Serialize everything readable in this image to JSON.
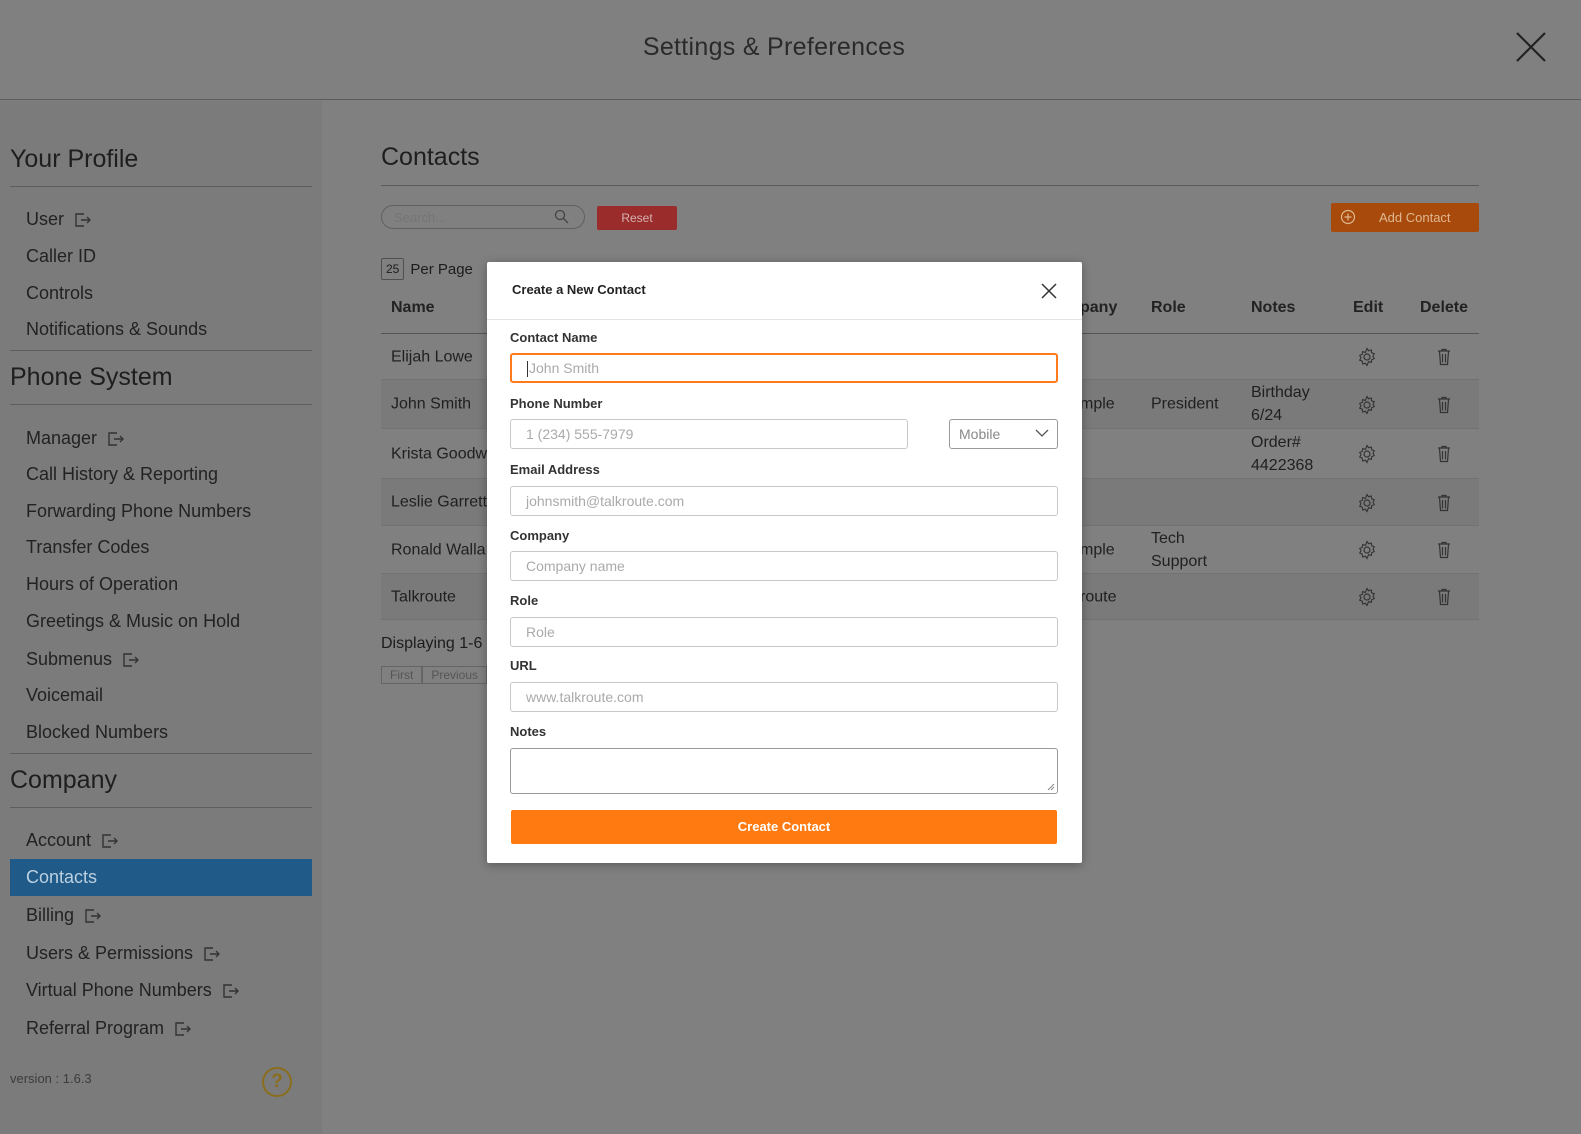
{
  "header": {
    "title": "Settings & Preferences",
    "close_icon": "close-icon"
  },
  "sidebar": {
    "sections": [
      {
        "title": "Your Profile",
        "items": [
          {
            "label": "User",
            "external": true
          },
          {
            "label": "Caller ID"
          },
          {
            "label": "Controls"
          },
          {
            "label": "Notifications & Sounds"
          }
        ]
      },
      {
        "title": "Phone System",
        "items": [
          {
            "label": "Manager",
            "external": true
          },
          {
            "label": "Call History & Reporting"
          },
          {
            "label": "Forwarding Phone Numbers"
          },
          {
            "label": "Transfer Codes"
          },
          {
            "label": "Hours of Operation"
          },
          {
            "label": "Greetings & Music on Hold"
          },
          {
            "label": "Submenus",
            "external": true
          },
          {
            "label": "Voicemail"
          },
          {
            "label": "Blocked Numbers"
          }
        ]
      },
      {
        "title": "Company",
        "items": [
          {
            "label": "Account",
            "external": true
          },
          {
            "label": "Contacts",
            "active": true
          },
          {
            "label": "Billing",
            "external": true
          },
          {
            "label": "Users & Permissions",
            "external": true
          },
          {
            "label": "Virtual Phone Numbers",
            "external": true
          },
          {
            "label": "Referral Program",
            "external": true
          }
        ]
      }
    ],
    "version": "version : 1.6.3",
    "help_icon": "question-circle-icon"
  },
  "main": {
    "title": "Contacts",
    "search_placeholder": "Search...",
    "reset_label": "Reset",
    "add_contact_label": "Add Contact",
    "per_page_value": "25",
    "per_page_label": "Per Page",
    "columns": [
      "Name",
      "pany",
      "Role",
      "Notes",
      "Edit",
      "Delete"
    ],
    "rows": [
      {
        "name": "Elijah Lowe",
        "company": "",
        "role": "",
        "notes": ""
      },
      {
        "name": "John Smith",
        "company": "mple",
        "role": "President",
        "notes": "Birthday 6/24"
      },
      {
        "name": "Krista Goodw",
        "company": "",
        "role": "",
        "notes": "Order# 4422368"
      },
      {
        "name": "Leslie Garrett",
        "company": "",
        "role": "",
        "notes": ""
      },
      {
        "name": "Ronald Walla",
        "company": "mple",
        "role": "Tech Support",
        "notes": ""
      },
      {
        "name": "Talkroute",
        "company": "route",
        "role": "",
        "notes": ""
      }
    ],
    "displaying": "Displaying 1-6",
    "pagination": [
      "First",
      "Previous"
    ]
  },
  "modal": {
    "title": "Create a New Contact",
    "fields": {
      "contact_name": {
        "label": "Contact Name",
        "placeholder": "John Smith"
      },
      "phone": {
        "label": "Phone Number",
        "placeholder": "1 (234) 555-7979",
        "type_selected": "Mobile"
      },
      "email": {
        "label": "Email Address",
        "placeholder": "johnsmith@talkroute.com"
      },
      "company": {
        "label": "Company",
        "placeholder": "Company name"
      },
      "role": {
        "label": "Role",
        "placeholder": "Role"
      },
      "url": {
        "label": "URL",
        "placeholder": "www.talkroute.com"
      },
      "notes": {
        "label": "Notes",
        "placeholder": ""
      }
    },
    "submit_label": "Create Contact"
  },
  "colors": {
    "accent": "#ff7a10",
    "active_nav": "#1f5a88",
    "reset": "#9a2c2c"
  }
}
